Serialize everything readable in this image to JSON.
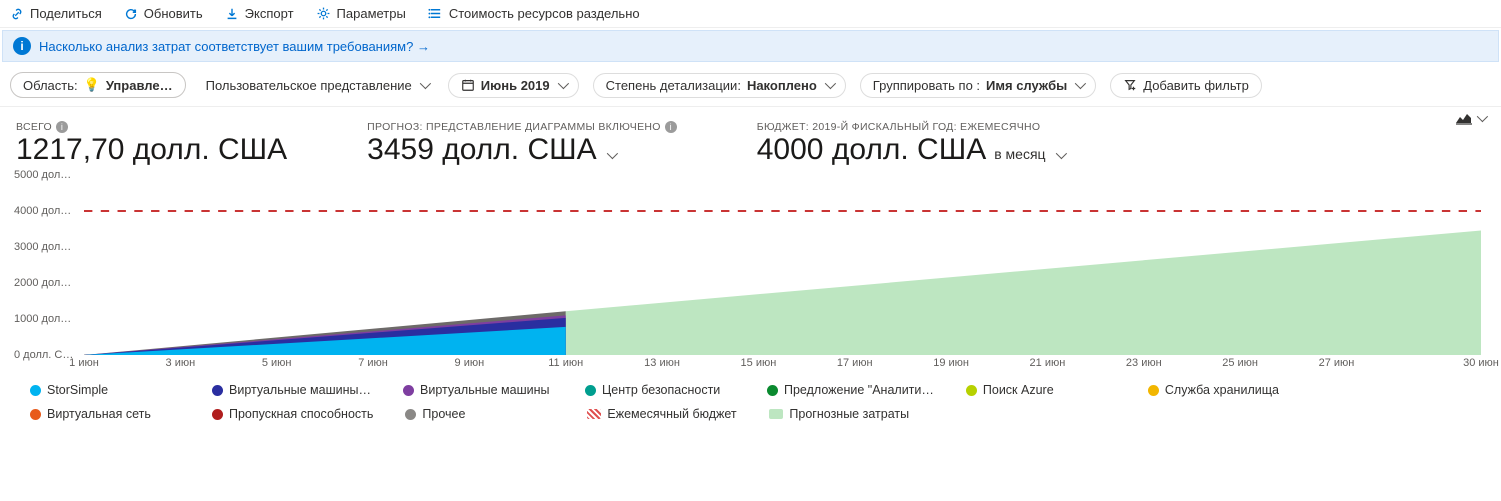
{
  "toolbar": {
    "share": "Поделиться",
    "refresh": "Обновить",
    "export": "Экспорт",
    "params": "Параметры",
    "split_cost": "Стоимость ресурсов раздельно"
  },
  "banner": {
    "text": "Насколько анализ затрат соответствует вашим требованиям? →"
  },
  "filters": {
    "scope_label": "Область:",
    "scope_value": "Управле…",
    "view": "Пользовательское представление",
    "period": "Июнь 2019",
    "granularity_label": "Степень детализации:",
    "granularity_value": "Накоплено",
    "group_label": "Группировать по :",
    "group_value": "Имя службы",
    "add_filter": "Добавить фильтр"
  },
  "summary": {
    "total_label": "ВСЕГО",
    "total_value": "1217,70 долл. США",
    "forecast_label": "ПРОГНОЗ: ПРЕДСТАВЛЕНИЕ ДИАГРАММЫ ВКЛЮЧЕНО",
    "forecast_value": "3459 долл. США",
    "budget_label": "БЮДЖЕТ: 2019-Й ФИСКАЛЬНЫЙ ГОД: ЕЖЕМЕСЯЧНО",
    "budget_value": "4000 долл. США",
    "budget_suffix": "в месяц"
  },
  "legend": [
    {
      "label": "StorSimple",
      "color": "#00b3f0"
    },
    {
      "label": "Виртуальные машины…",
      "color": "#2a2ea0"
    },
    {
      "label": "Виртуальные машины",
      "color": "#7e3ea0"
    },
    {
      "label": "Центр безопасности",
      "color": "#009e8f"
    },
    {
      "label": "Предложение \"Аналити…",
      "color": "#0a8a2f"
    },
    {
      "label": "Поиск Azure",
      "color": "#b7d100"
    },
    {
      "label": "Служба хранилища",
      "color": "#f2b600"
    },
    {
      "label": "Виртуальная сеть",
      "color": "#e85a1a"
    },
    {
      "label": "Пропускная способность",
      "color": "#b01e1e"
    },
    {
      "label": "Прочее",
      "color": "#8a8886"
    }
  ],
  "legend_extra": {
    "budget": "Ежемесячный бюджет",
    "forecast": "Прогнозные затраты"
  },
  "chart_data": {
    "type": "area",
    "xlabel": "",
    "ylabel": "",
    "ylim": [
      0,
      5000
    ],
    "y_ticks": [
      "0 долл. С…",
      "1000 дол…",
      "2000 дол…",
      "3000 дол…",
      "4000 дол…",
      "5000 дол…"
    ],
    "x_ticks": [
      "1 июн",
      "3 июн",
      "5 июн",
      "7 июн",
      "9 июн",
      "11 июн",
      "13 июн",
      "15 июн",
      "17 июн",
      "19 июн",
      "21 июн",
      "23 июн",
      "25 июн",
      "27 июн",
      "30 июн"
    ],
    "x_domain": [
      1,
      30
    ],
    "budget_line": 4000,
    "series": [
      {
        "name": "StorSimple",
        "color": "#00b3f0",
        "values_at": {
          "1": 0,
          "11": 780
        }
      },
      {
        "name": "Виртуальные машины…",
        "color": "#2a2ea0",
        "values_at": {
          "1": 0,
          "11": 1030
        }
      },
      {
        "name": "Виртуальные машины",
        "color": "#7e3ea0",
        "values_at": {
          "1": 0,
          "11": 1100
        }
      },
      {
        "name": "Прочие службы (стек)",
        "color": "#6d6a69",
        "values_at": {
          "1": 0,
          "11": 1217
        }
      }
    ],
    "forecast": {
      "color": "#bde6c1",
      "start_x": 11,
      "start_y": 1217,
      "end_x": 30,
      "end_y": 3459
    }
  }
}
